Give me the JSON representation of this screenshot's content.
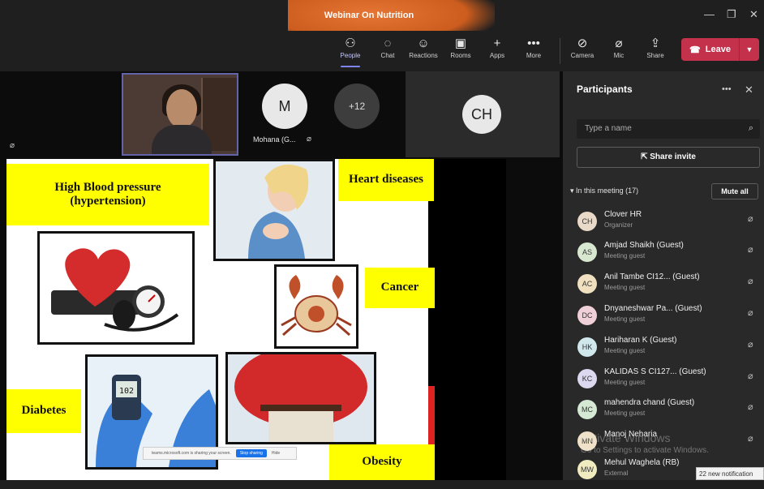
{
  "window": {
    "title": "Webinar On Nutrition"
  },
  "toolbar": {
    "items": [
      {
        "label": "People",
        "icon": "people-icon"
      },
      {
        "label": "Chat",
        "icon": "chat-icon"
      },
      {
        "label": "Reactions",
        "icon": "reactions-icon"
      },
      {
        "label": "Rooms",
        "icon": "rooms-icon"
      },
      {
        "label": "Apps",
        "icon": "plus-icon"
      },
      {
        "label": "More",
        "icon": "more-icon"
      },
      {
        "label": "Camera",
        "icon": "camera-off-icon"
      },
      {
        "label": "Mic",
        "icon": "mic-off-icon"
      },
      {
        "label": "Share",
        "icon": "share-icon"
      }
    ],
    "leave_label": "Leave"
  },
  "stage": {
    "tiles": [
      {
        "initial": "M",
        "name": "Mohana (G..."
      },
      {
        "more_count": "+12"
      },
      {
        "initials": "CH"
      }
    ]
  },
  "slide": {
    "labels": {
      "hbp": "High Blood pressure (hypertension)",
      "heart": "Heart diseases",
      "cancer": "Cancer",
      "diabetes": "Diabetes",
      "obesity": "Obesity"
    },
    "glucose_reading": "102"
  },
  "share_bar": {
    "text": "teams.microsoft.com is sharing your screen.",
    "stop": "Stop sharing",
    "hide": "Hide"
  },
  "panel": {
    "title": "Participants",
    "search_placeholder": "Type a name",
    "invite_label": "Share invite",
    "section_label": "In this meeting (17)",
    "mute_all": "Mute all",
    "participants": [
      {
        "initials": "CH",
        "name": "Clover HR",
        "role": "Organizer",
        "color": "#e8d9c8"
      },
      {
        "initials": "AS",
        "name": "Amjad Shaikh (Guest)",
        "role": "Meeting guest",
        "color": "#d8e8d0"
      },
      {
        "initials": "AC",
        "name": "Anil Tambe CI12... (Guest)",
        "role": "Meeting guest",
        "color": "#f0e0c0"
      },
      {
        "initials": "DC",
        "name": "Dnyaneshwar Pa... (Guest)",
        "role": "Meeting guest",
        "color": "#f0d0d8"
      },
      {
        "initials": "HK",
        "name": "Hariharan K (Guest)",
        "role": "Meeting guest",
        "color": "#d0e8ec"
      },
      {
        "initials": "KC",
        "name": "KALIDAS S CI127... (Guest)",
        "role": "Meeting guest",
        "color": "#dcd8f0"
      },
      {
        "initials": "MC",
        "name": "mahendra chand (Guest)",
        "role": "Meeting guest",
        "color": "#d4e8d4"
      },
      {
        "initials": "MN",
        "name": "Manoj Neharia",
        "role": "",
        "color": "#efe2c8"
      },
      {
        "initials": "MW",
        "name": "Mehul Waghela (RB)",
        "role": "External",
        "color": "#f0ecc0"
      }
    ]
  },
  "watermark": {
    "line1": "Activate Windows",
    "line2": "Go to Settings to activate Windows."
  },
  "notification": "22 new notification"
}
